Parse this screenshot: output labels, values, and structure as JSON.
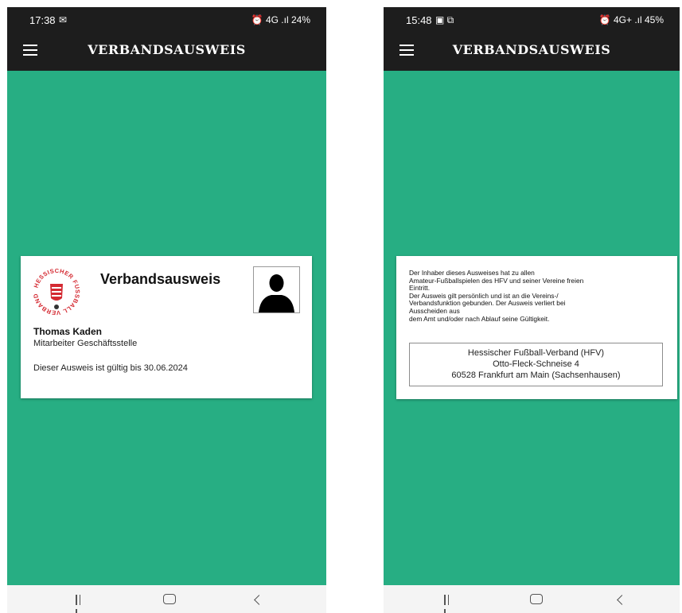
{
  "colors": {
    "accent": "#27ae83",
    "app_bar": "#1d1d1d",
    "logo_red": "#d42a32"
  },
  "left_screen": {
    "status": {
      "time": "17:38",
      "left_icons": "✉",
      "right_icons": "⏰ 4G .ıl 24%"
    },
    "app_title": "VERBANDSAUSWEIS",
    "card": {
      "title": "Verbandsausweis",
      "logo_text": "HESSISCHER FUSSBALL VERBAND",
      "holder_name": "Thomas Kaden",
      "holder_role": "Mitarbeiter Geschäftsstelle",
      "validity": "Dieser Ausweis ist gültig bis 30.06.2024"
    }
  },
  "right_screen": {
    "status": {
      "time": "15:48",
      "left_icons": "▣ ⧉",
      "right_icons": "⏰ 4G+ .ıl 45%"
    },
    "app_title": "VERBANDSAUSWEIS",
    "card": {
      "info_lines": [
        "Der Inhaber dieses Ausweises hat zu allen",
        "Amateur-Fußballspielen des HFV und seiner Vereine freien",
        "Eintritt.",
        "Der Ausweis gilt persönlich und ist an die Vereins-/",
        "Verbandsfunktion gebunden. Der Ausweis verliert bei",
        "Ausscheiden aus",
        "dem Amt und/oder nach Ablauf seine Gültigkeit."
      ],
      "address": {
        "org": "Hessischer Fußball-Verband (HFV)",
        "street": "Otto-Fleck-Schneise 4",
        "city": "60528 Frankfurt am Main (Sachsenhausen)"
      }
    }
  },
  "icons": {
    "menu": "hamburger-menu-icon",
    "alarm": "alarm-icon",
    "signal": "signal-icon",
    "battery": "battery-icon",
    "recents": "recents-icon",
    "home": "home-icon",
    "back": "back-icon",
    "photo": "person-silhouette-icon"
  }
}
